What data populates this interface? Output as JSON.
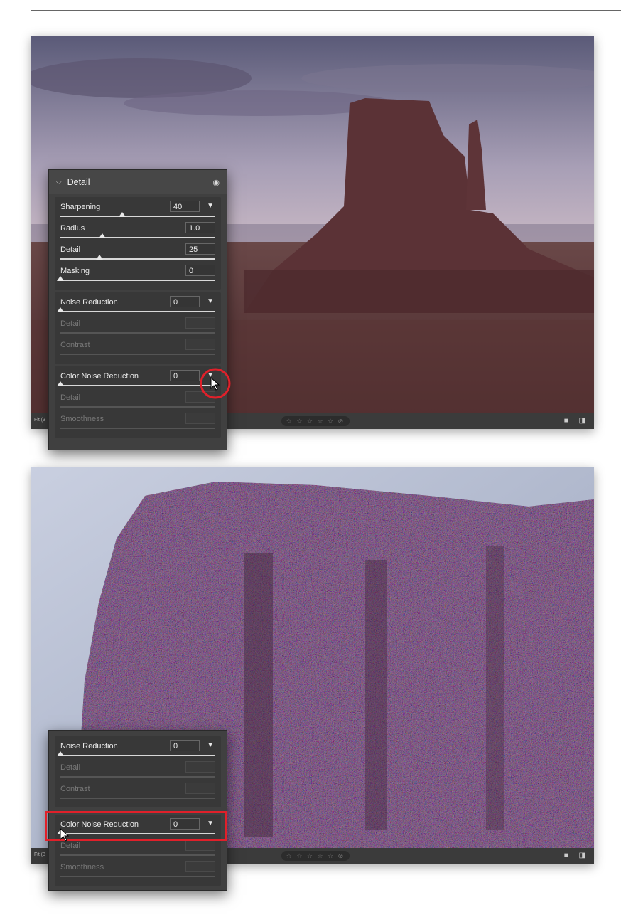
{
  "top": {
    "detail_panel": {
      "title": "Detail",
      "sharpening": [
        {
          "label": "Sharpening",
          "value": "40",
          "has_menu": true,
          "level": 0.4
        },
        {
          "label": "Radius",
          "value": "1.0",
          "level": 0.27
        },
        {
          "label": "Detail",
          "value": "25",
          "level": 0.25
        },
        {
          "label": "Masking",
          "value": "0",
          "level": 0.0
        }
      ],
      "noise_reduction": {
        "label": "Noise Reduction",
        "value": "0",
        "level": 0.0
      },
      "nr_sub": [
        {
          "label": "Detail"
        },
        {
          "label": "Contrast"
        }
      ],
      "color_noise_reduction": {
        "label": "Color Noise Reduction",
        "value": "0",
        "level": 0.0
      },
      "cnr_sub": [
        {
          "label": "Detail"
        },
        {
          "label": "Smoothness"
        }
      ]
    },
    "status": {
      "fit_label": "Fit (3",
      "stars": "☆ ☆ ☆ ☆ ☆ ⊘"
    }
  },
  "bottom": {
    "panel": {
      "noise_reduction": {
        "label": "Noise Reduction",
        "value": "0",
        "level": 0.0
      },
      "nr_sub": [
        {
          "label": "Detail"
        },
        {
          "label": "Contrast"
        }
      ],
      "color_noise_reduction": {
        "label": "Color Noise Reduction",
        "value": "0",
        "level": 0.0
      },
      "cnr_sub": [
        {
          "label": "Detail"
        },
        {
          "label": "Smoothness"
        }
      ]
    },
    "status": {
      "fit_label": "Fit (3",
      "stars": "☆ ☆ ☆ ☆ ☆ ⊘"
    }
  },
  "colors": {
    "highlight_red": "#e0202a",
    "panel_bg": "#404040"
  }
}
